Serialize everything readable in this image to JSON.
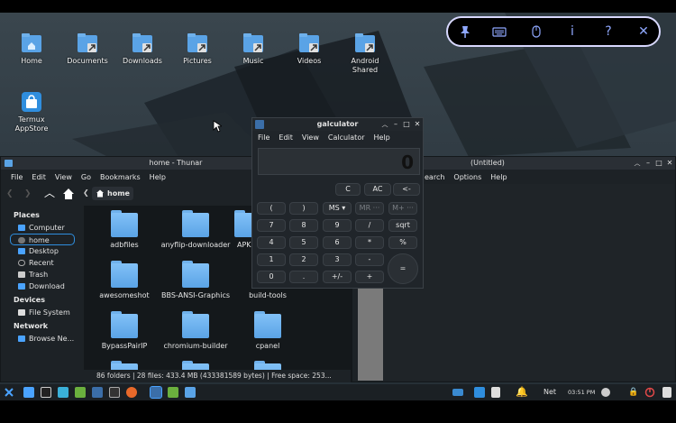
{
  "desktop": {
    "icons": [
      {
        "label": "Home"
      },
      {
        "label": "Documents"
      },
      {
        "label": "Downloads"
      },
      {
        "label": "Pictures"
      },
      {
        "label": "Music"
      },
      {
        "label": "Videos"
      },
      {
        "label": "Android Shared"
      },
      {
        "label": "Termux AppStore"
      }
    ]
  },
  "remote_toolbar": {
    "buttons": [
      {
        "icon": "pin-icon",
        "glyph": "📌"
      },
      {
        "icon": "keyboard-icon",
        "glyph": "⌨"
      },
      {
        "icon": "mouse-icon",
        "glyph": "🖱"
      },
      {
        "icon": "info-icon",
        "glyph": "i"
      },
      {
        "icon": "help-icon",
        "glyph": "?"
      },
      {
        "icon": "close-icon",
        "glyph": "✕"
      }
    ]
  },
  "thunar": {
    "title": "home - Thunar",
    "menu": [
      "File",
      "Edit",
      "View",
      "Go",
      "Bookmarks",
      "Help"
    ],
    "path_label": "home",
    "sidebar": {
      "places_heading": "Places",
      "places": [
        "Computer",
        "home",
        "Desktop",
        "Recent",
        "Trash",
        "Download"
      ],
      "devices_heading": "Devices",
      "devices": [
        "File System"
      ],
      "network_heading": "Network",
      "network": [
        "Browse Ne..."
      ]
    },
    "files": [
      "adbfiles",
      "anyflip-downloader",
      "APK",
      "awesomeshot",
      "BBS-ANSI-Graphics",
      "build-tools",
      "BypassPairIP",
      "chromium-builder",
      "cpanel"
    ],
    "status": "86 folders  |  28 files: 433.4 MB (433381589 bytes)  |  Free space: 253..."
  },
  "editor": {
    "title": "(Untitled)",
    "menu_partial": "earch",
    "menu": [
      "Options",
      "Help"
    ]
  },
  "calculator": {
    "title": "galculator",
    "menu": [
      "File",
      "Edit",
      "View",
      "Calculator",
      "Help"
    ],
    "display": "0",
    "buttons": {
      "c": "C",
      "ac": "AC",
      "back": "<-",
      "lparen": "(",
      "rparen": ")",
      "ms": "MS ▾",
      "mr": "MR ···",
      "mplus": "M+ ···",
      "n7": "7",
      "n8": "8",
      "n9": "9",
      "div": "/",
      "sqrt": "sqrt",
      "n4": "4",
      "n5": "5",
      "n6": "6",
      "mul": "*",
      "pct": "%",
      "n1": "1",
      "n2": "2",
      "n3": "3",
      "sub": "-",
      "eq": "=",
      "n0": "0",
      "dot": ".",
      "pm": "+/-",
      "add": "+"
    }
  },
  "taskbar": {
    "net_label": "Net",
    "clock": "03:51 PM"
  },
  "colors": {
    "accent": "#2f8ede",
    "folder": "#6fb1ec",
    "toolbar_border": "#d8d8ff",
    "toolbar_icon": "#8fa8ff"
  }
}
